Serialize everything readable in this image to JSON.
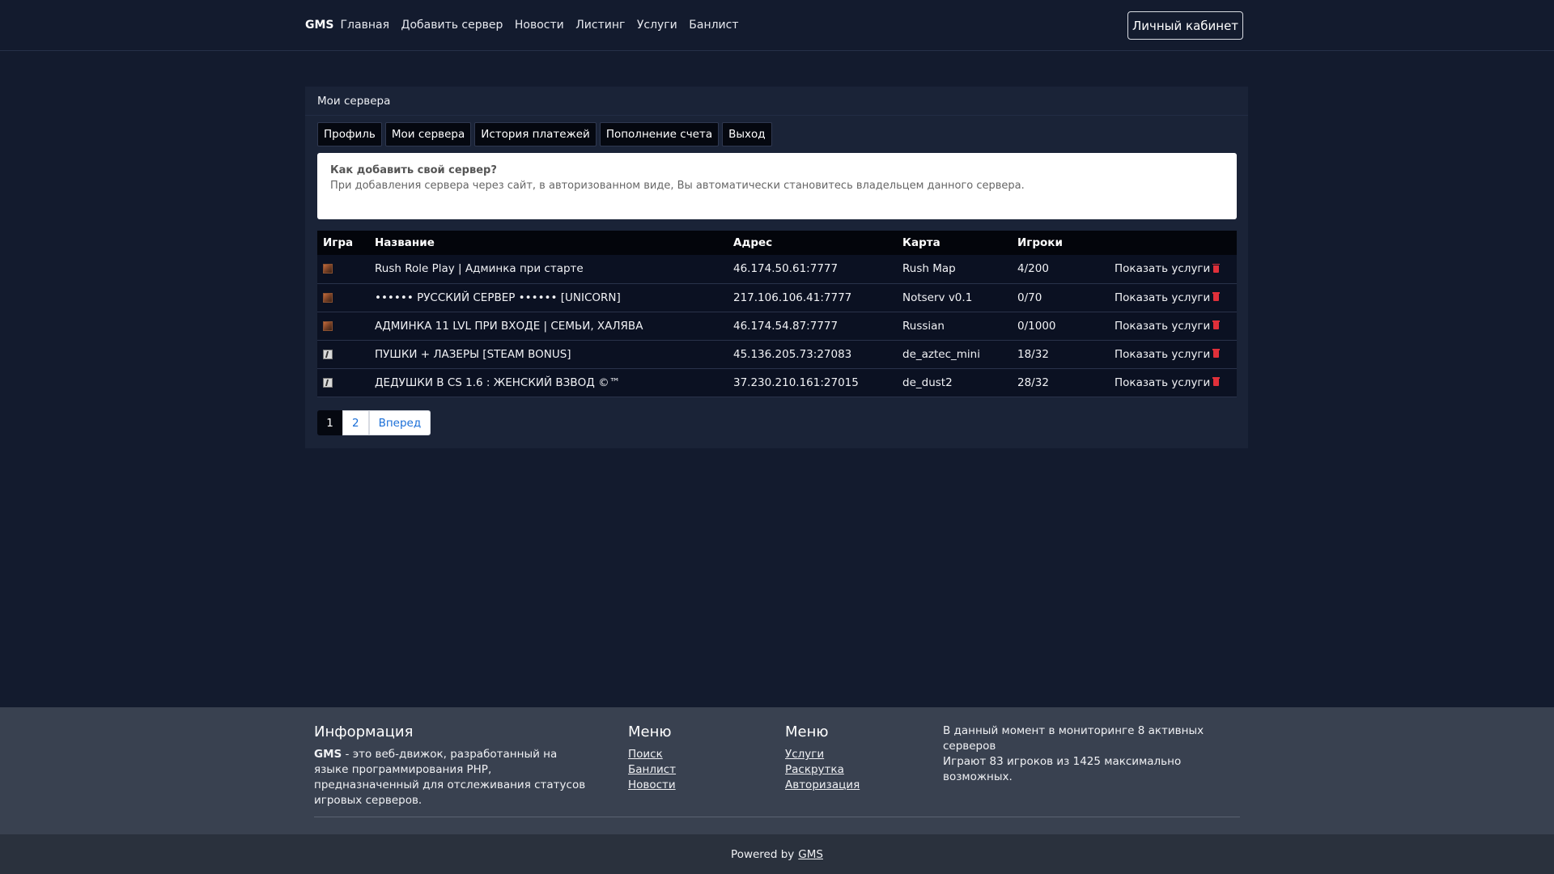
{
  "navbar": {
    "brand": "GMS",
    "links": [
      "Главная",
      "Добавить сервер",
      "Новости",
      "Листинг",
      "Услуги",
      "Банлист"
    ],
    "cabinet_button": "Личный кабинет"
  },
  "panel": {
    "title": "Мои сервера",
    "tabs": [
      "Профиль",
      "Мои сервера",
      "История платежей",
      "Пополнение счета",
      "Выход"
    ],
    "info": {
      "title": "Как добавить свой сервер?",
      "text": "При добавления сервера через сайт, в авторизованном виде, Вы автоматически становитесь владельцем данного сервера."
    },
    "table": {
      "headers": [
        "Игра",
        "Название",
        "Адрес",
        "Карта",
        "Игроки",
        ""
      ],
      "action_label": "Показать услуги",
      "rows": [
        {
          "game_icon": "gmod-icon",
          "name": "Rush Role Play | Админка при старте",
          "address": "46.174.50.61:7777",
          "map": "Rush Map",
          "players": "4/200"
        },
        {
          "game_icon": "gmod-icon",
          "name": "•••••• РУССКИЙ СЕРВЕР •••••• [UNICORN]",
          "address": "217.106.106.41:7777",
          "map": "Notserv v0.1",
          "players": "0/70"
        },
        {
          "game_icon": "gmod-icon",
          "name": "АДМИНКА 11 LVL ПРИ ВХОДЕ | СЕМЬИ, ХАЛЯВА",
          "address": "46.174.54.87:7777",
          "map": "Russian",
          "players": "0/1000"
        },
        {
          "game_icon": "cs-icon",
          "name": "ПУШКИ + ЛАЗЕРЫ [STEAM BONUS]",
          "address": "45.136.205.73:27083",
          "map": "de_aztec_mini",
          "players": "18/32"
        },
        {
          "game_icon": "cs-icon",
          "name": "ДЕДУШКИ В CS 1.6 : ЖЕНСКИЙ ВЗВОД ©™",
          "address": "37.230.210.161:27015",
          "map": "de_dust2",
          "players": "28/32"
        }
      ]
    },
    "pagination": {
      "pages": [
        "1",
        "2"
      ],
      "next": "Вперед",
      "current": "1"
    }
  },
  "footer": {
    "info_title": "Информация",
    "info_brand": "GMS",
    "info_text": " - это веб-движок, разработанный на языке программирования PHP, предназначенный для отслеживания статусов игровых серверов.",
    "menu1": {
      "title": "Меню",
      "links": [
        "Поиск",
        "Банлист",
        "Новости"
      ]
    },
    "menu2": {
      "title": "Меню",
      "links": [
        "Услуги",
        "Раскрутка",
        "Авторизация"
      ]
    },
    "stats": [
      "В данный момент в мониторинге 8 активных серверов",
      "Играют 83 игроков из 1425 максимально возможных."
    ],
    "powered_by": "Powered by",
    "powered_link": "GMS"
  },
  "colors": {
    "background": "#131b2e",
    "panel": "#1a2337",
    "footer": "#394150",
    "accent_link": "#1a6fd8",
    "trash": "#e0303a"
  }
}
